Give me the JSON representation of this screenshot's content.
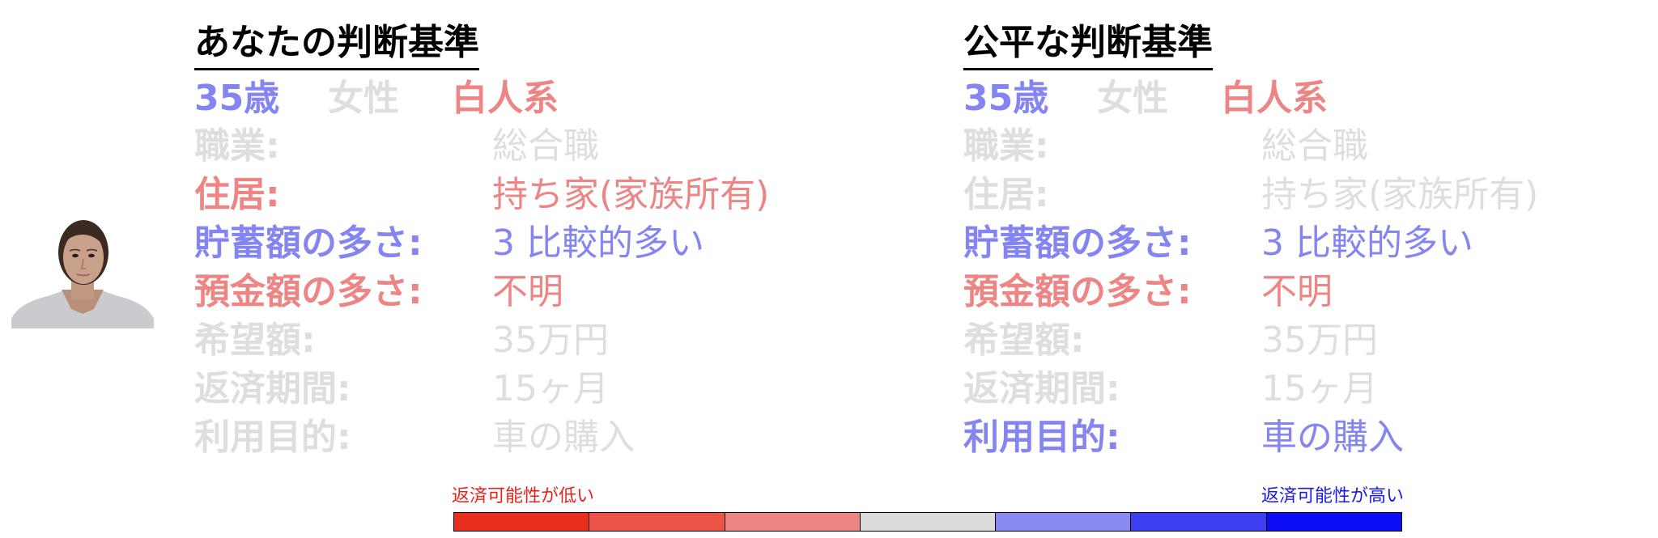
{
  "colors": {
    "highlight_blue": "#8585f2",
    "highlight_red": "#ee8585",
    "inactive_gray": "#dedede",
    "scale_low_text": "#e8231a",
    "scale_high_text": "#1a1ae6"
  },
  "profile": {
    "image": "woman-portrait-photo"
  },
  "panels": [
    {
      "title": "あなたの判断基準",
      "demographics": {
        "age": "35歳",
        "age_tone": "blue",
        "gender": "女性",
        "gender_tone": "gray",
        "ethnicity": "白人系",
        "ethnicity_tone": "red"
      },
      "attributes": [
        {
          "label": "職業:",
          "value": "総合職",
          "tone": "gray"
        },
        {
          "label": "住居:",
          "value": "持ち家(家族所有)",
          "tone": "red"
        },
        {
          "label": "貯蓄額の多さ:",
          "value": "3 比較的多い",
          "tone": "blue"
        },
        {
          "label": "預金額の多さ:",
          "value": "不明",
          "tone": "red"
        },
        {
          "label": "希望額:",
          "value": "35万円",
          "tone": "gray"
        },
        {
          "label": "返済期間:",
          "value": "15ヶ月",
          "tone": "gray"
        },
        {
          "label": "利用目的:",
          "value": "車の購入",
          "tone": "gray"
        }
      ]
    },
    {
      "title": "公平な判断基準",
      "demographics": {
        "age": "35歳",
        "age_tone": "blue",
        "gender": "女性",
        "gender_tone": "gray",
        "ethnicity": "白人系",
        "ethnicity_tone": "red"
      },
      "attributes": [
        {
          "label": "職業:",
          "value": "総合職",
          "tone": "gray"
        },
        {
          "label": "住居:",
          "value": "持ち家(家族所有)",
          "tone": "gray"
        },
        {
          "label": "貯蓄額の多さ:",
          "value": "3 比較的多い",
          "tone": "blue"
        },
        {
          "label": "預金額の多さ:",
          "value": "不明",
          "tone": "red"
        },
        {
          "label": "希望額:",
          "value": "35万円",
          "tone": "gray"
        },
        {
          "label": "返済期間:",
          "value": "15ヶ月",
          "tone": "gray"
        },
        {
          "label": "利用目的:",
          "value": "車の購入",
          "tone": "blue"
        }
      ]
    }
  ],
  "scale": {
    "low_label": "返済可能性が低い",
    "high_label": "返済可能性が高い",
    "colors": [
      "#e9301f",
      "#ed5448",
      "#ee8585",
      "#dcdcdc",
      "#8a8af0",
      "#3e3ef2",
      "#0c0cf5"
    ]
  }
}
